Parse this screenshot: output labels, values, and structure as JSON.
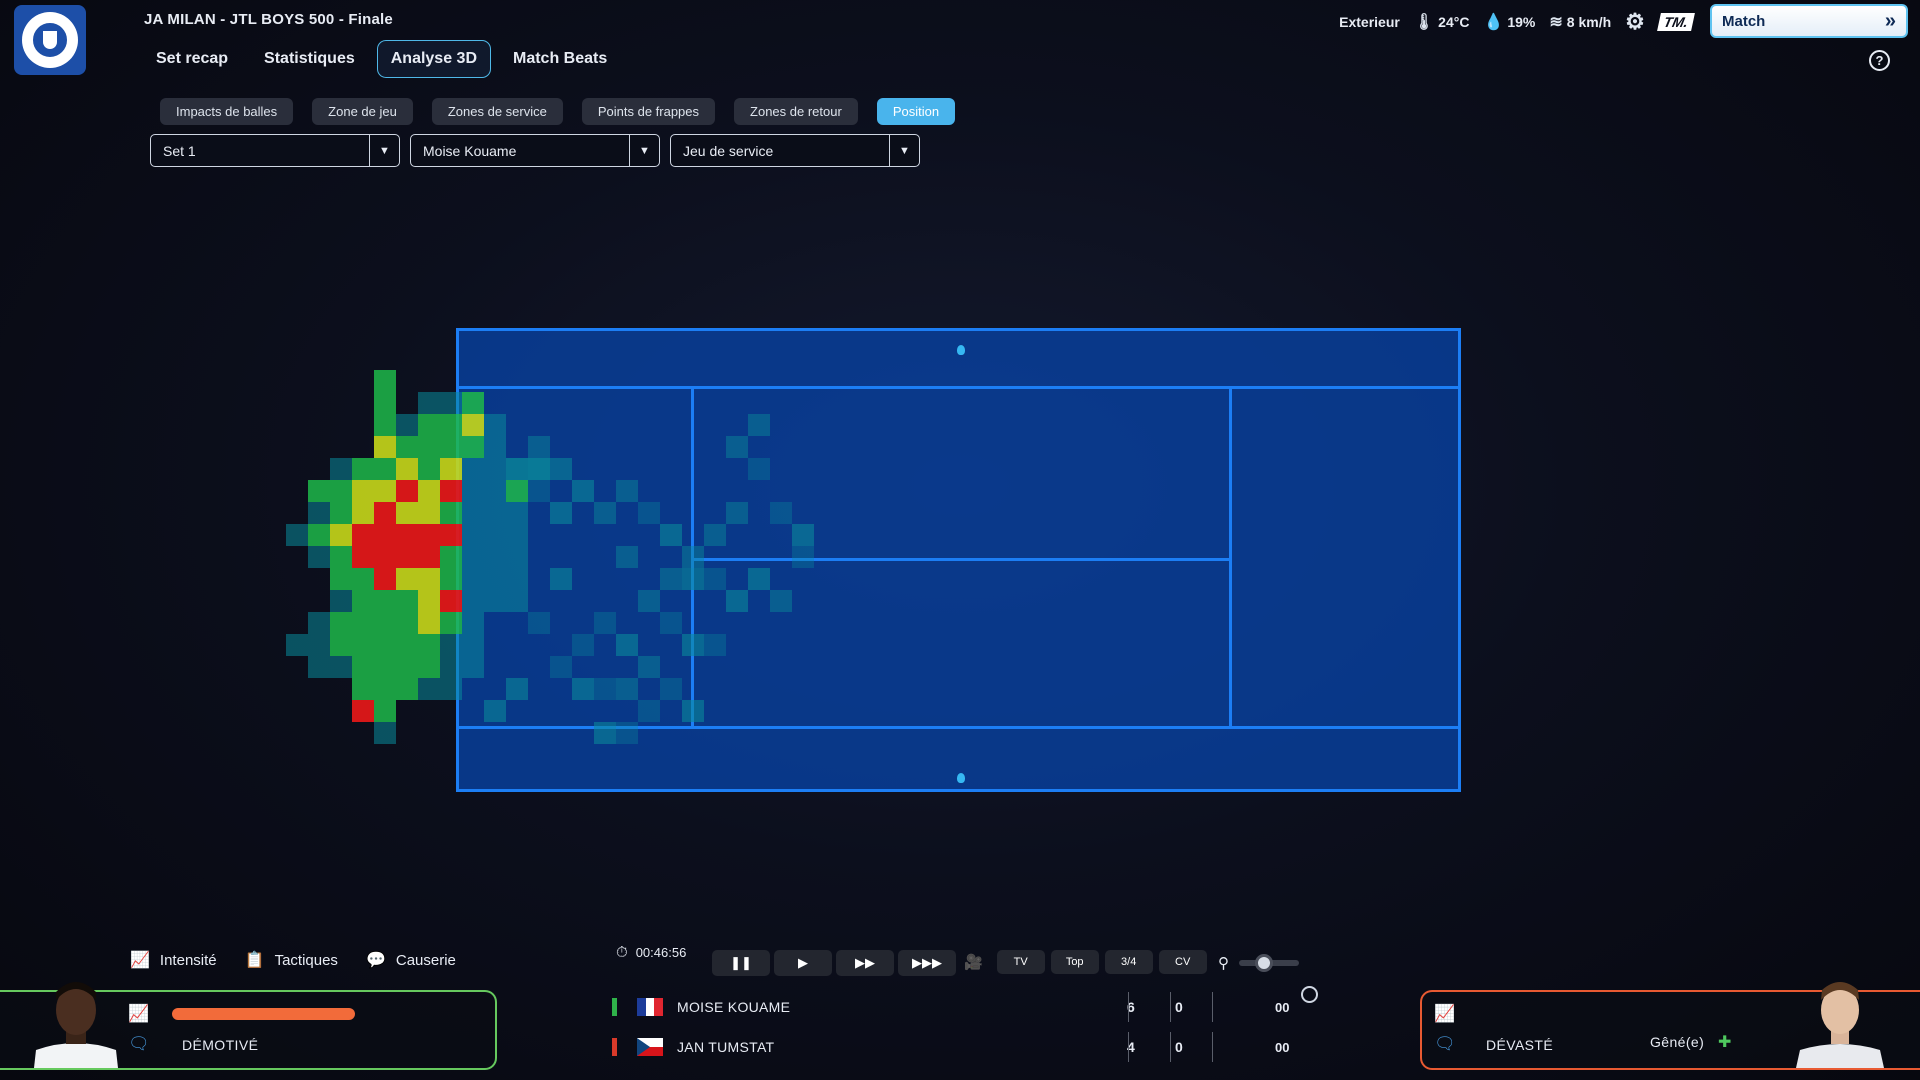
{
  "header": {
    "match_title": "JA MILAN - JTL BOYS 500 - Finale",
    "tabs": [
      {
        "label": "Set recap",
        "active": false
      },
      {
        "label": "Statistiques",
        "active": false
      },
      {
        "label": "Analyse 3D",
        "active": true
      },
      {
        "label": "Match Beats",
        "active": false
      }
    ],
    "weather": {
      "conditions": "Exterieur",
      "temperature": "24°C",
      "humidity": "19%",
      "wind": "8 km/h"
    },
    "brand_logo_text": "TM.",
    "match_button_label": "Match",
    "match_button_chevron": "»",
    "help_label": "?"
  },
  "analysis": {
    "sub_tabs": [
      {
        "label": "Impacts de balles",
        "active": false
      },
      {
        "label": "Zone de jeu",
        "active": false
      },
      {
        "label": "Zones de service",
        "active": false
      },
      {
        "label": "Points de frappes",
        "active": false
      },
      {
        "label": "Zones de retour",
        "active": false
      },
      {
        "label": "Position",
        "active": true
      }
    ],
    "filters": {
      "set": "Set 1",
      "player": "Moise Kouame",
      "game_type": "Jeu de service"
    }
  },
  "heatmap": {
    "description_colors": {
      "low": "#0a8a9a",
      "mid": "#1eb84a",
      "high": "#c6d81a",
      "peak": "#e01818"
    }
  },
  "controls": {
    "intensity_label": "Intensité",
    "tactics_label": "Tactiques",
    "talk_label": "Causerie",
    "match_time": "00:46:56",
    "camera_buttons": [
      "TV",
      "Top",
      "3/4",
      "CV"
    ],
    "zoom_level": 0.42
  },
  "players": {
    "left": {
      "mood": "DÉMOTIVÉ",
      "energy": 0.85,
      "energy_color": "#f26b3a",
      "card_color": "#66c95e"
    },
    "right": {
      "mood": "DÉVASTÉ",
      "status": "Gêné(e)",
      "card_color": "#e85a32"
    }
  },
  "scoreboard": {
    "rows": [
      {
        "name": "MOISE KOUAME",
        "sets": "6",
        "games": "0",
        "points": "00",
        "stripe": "#2fb34a"
      },
      {
        "name": "JAN TUMSTAT",
        "sets": "4",
        "games": "0",
        "points": "00",
        "stripe": "#d93a2a"
      }
    ]
  }
}
